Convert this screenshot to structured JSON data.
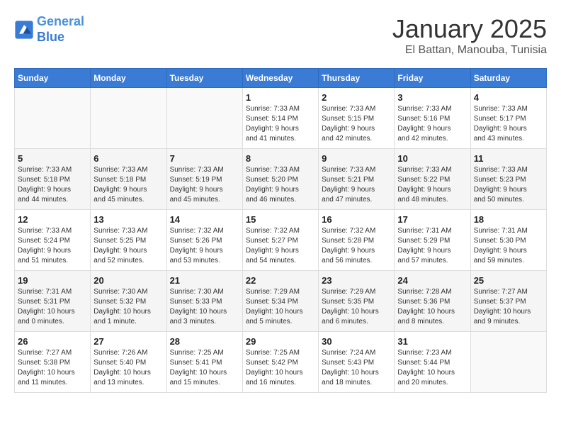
{
  "logo": {
    "line1": "General",
    "line2": "Blue"
  },
  "title": "January 2025",
  "subtitle": "El Battan, Manouba, Tunisia",
  "weekdays": [
    "Sunday",
    "Monday",
    "Tuesday",
    "Wednesday",
    "Thursday",
    "Friday",
    "Saturday"
  ],
  "weeks": [
    [
      {
        "day": "",
        "info": ""
      },
      {
        "day": "",
        "info": ""
      },
      {
        "day": "",
        "info": ""
      },
      {
        "day": "1",
        "info": "Sunrise: 7:33 AM\nSunset: 5:14 PM\nDaylight: 9 hours\nand 41 minutes."
      },
      {
        "day": "2",
        "info": "Sunrise: 7:33 AM\nSunset: 5:15 PM\nDaylight: 9 hours\nand 42 minutes."
      },
      {
        "day": "3",
        "info": "Sunrise: 7:33 AM\nSunset: 5:16 PM\nDaylight: 9 hours\nand 42 minutes."
      },
      {
        "day": "4",
        "info": "Sunrise: 7:33 AM\nSunset: 5:17 PM\nDaylight: 9 hours\nand 43 minutes."
      }
    ],
    [
      {
        "day": "5",
        "info": "Sunrise: 7:33 AM\nSunset: 5:18 PM\nDaylight: 9 hours\nand 44 minutes."
      },
      {
        "day": "6",
        "info": "Sunrise: 7:33 AM\nSunset: 5:18 PM\nDaylight: 9 hours\nand 45 minutes."
      },
      {
        "day": "7",
        "info": "Sunrise: 7:33 AM\nSunset: 5:19 PM\nDaylight: 9 hours\nand 45 minutes."
      },
      {
        "day": "8",
        "info": "Sunrise: 7:33 AM\nSunset: 5:20 PM\nDaylight: 9 hours\nand 46 minutes."
      },
      {
        "day": "9",
        "info": "Sunrise: 7:33 AM\nSunset: 5:21 PM\nDaylight: 9 hours\nand 47 minutes."
      },
      {
        "day": "10",
        "info": "Sunrise: 7:33 AM\nSunset: 5:22 PM\nDaylight: 9 hours\nand 48 minutes."
      },
      {
        "day": "11",
        "info": "Sunrise: 7:33 AM\nSunset: 5:23 PM\nDaylight: 9 hours\nand 50 minutes."
      }
    ],
    [
      {
        "day": "12",
        "info": "Sunrise: 7:33 AM\nSunset: 5:24 PM\nDaylight: 9 hours\nand 51 minutes."
      },
      {
        "day": "13",
        "info": "Sunrise: 7:33 AM\nSunset: 5:25 PM\nDaylight: 9 hours\nand 52 minutes."
      },
      {
        "day": "14",
        "info": "Sunrise: 7:32 AM\nSunset: 5:26 PM\nDaylight: 9 hours\nand 53 minutes."
      },
      {
        "day": "15",
        "info": "Sunrise: 7:32 AM\nSunset: 5:27 PM\nDaylight: 9 hours\nand 54 minutes."
      },
      {
        "day": "16",
        "info": "Sunrise: 7:32 AM\nSunset: 5:28 PM\nDaylight: 9 hours\nand 56 minutes."
      },
      {
        "day": "17",
        "info": "Sunrise: 7:31 AM\nSunset: 5:29 PM\nDaylight: 9 hours\nand 57 minutes."
      },
      {
        "day": "18",
        "info": "Sunrise: 7:31 AM\nSunset: 5:30 PM\nDaylight: 9 hours\nand 59 minutes."
      }
    ],
    [
      {
        "day": "19",
        "info": "Sunrise: 7:31 AM\nSunset: 5:31 PM\nDaylight: 10 hours\nand 0 minutes."
      },
      {
        "day": "20",
        "info": "Sunrise: 7:30 AM\nSunset: 5:32 PM\nDaylight: 10 hours\nand 1 minute."
      },
      {
        "day": "21",
        "info": "Sunrise: 7:30 AM\nSunset: 5:33 PM\nDaylight: 10 hours\nand 3 minutes."
      },
      {
        "day": "22",
        "info": "Sunrise: 7:29 AM\nSunset: 5:34 PM\nDaylight: 10 hours\nand 5 minutes."
      },
      {
        "day": "23",
        "info": "Sunrise: 7:29 AM\nSunset: 5:35 PM\nDaylight: 10 hours\nand 6 minutes."
      },
      {
        "day": "24",
        "info": "Sunrise: 7:28 AM\nSunset: 5:36 PM\nDaylight: 10 hours\nand 8 minutes."
      },
      {
        "day": "25",
        "info": "Sunrise: 7:27 AM\nSunset: 5:37 PM\nDaylight: 10 hours\nand 9 minutes."
      }
    ],
    [
      {
        "day": "26",
        "info": "Sunrise: 7:27 AM\nSunset: 5:38 PM\nDaylight: 10 hours\nand 11 minutes."
      },
      {
        "day": "27",
        "info": "Sunrise: 7:26 AM\nSunset: 5:40 PM\nDaylight: 10 hours\nand 13 minutes."
      },
      {
        "day": "28",
        "info": "Sunrise: 7:25 AM\nSunset: 5:41 PM\nDaylight: 10 hours\nand 15 minutes."
      },
      {
        "day": "29",
        "info": "Sunrise: 7:25 AM\nSunset: 5:42 PM\nDaylight: 10 hours\nand 16 minutes."
      },
      {
        "day": "30",
        "info": "Sunrise: 7:24 AM\nSunset: 5:43 PM\nDaylight: 10 hours\nand 18 minutes."
      },
      {
        "day": "31",
        "info": "Sunrise: 7:23 AM\nSunset: 5:44 PM\nDaylight: 10 hours\nand 20 minutes."
      },
      {
        "day": "",
        "info": ""
      }
    ]
  ]
}
